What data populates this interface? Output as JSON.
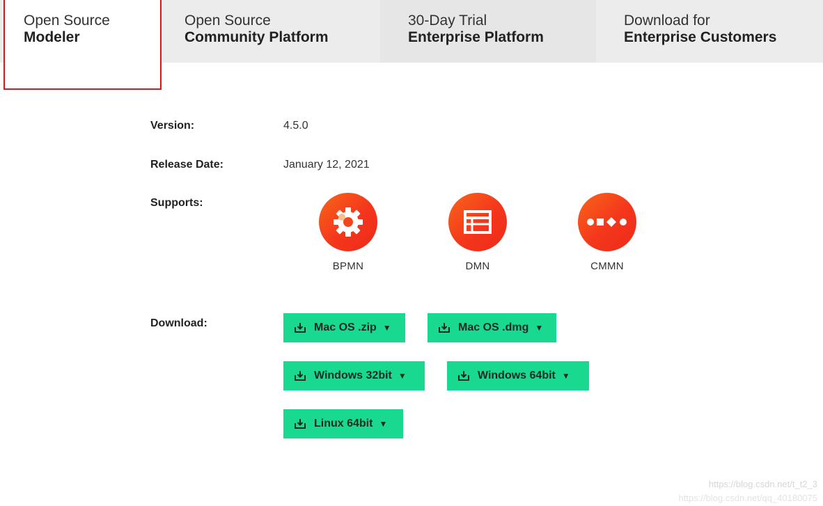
{
  "tabs": [
    {
      "line1": "Open Source",
      "line2": "Modeler",
      "active": true
    },
    {
      "line1": "Open Source",
      "line2": "Community Platform",
      "active": false
    },
    {
      "line1": "30-Day Trial",
      "line2": "Enterprise Platform",
      "active": false
    },
    {
      "line1": "Download for",
      "line2": "Enterprise Customers",
      "active": false
    }
  ],
  "info": {
    "version_label": "Version:",
    "version_value": "4.5.0",
    "release_label": "Release Date:",
    "release_value": "January 12, 2021",
    "supports_label": "Supports:",
    "download_label": "Download:"
  },
  "supports": [
    {
      "name": "BPMN",
      "icon": "gear-icon"
    },
    {
      "name": "DMN",
      "icon": "table-icon"
    },
    {
      "name": "CMMN",
      "icon": "case-shapes-icon"
    }
  ],
  "downloads": [
    {
      "label": "Mac OS .zip",
      "icon": "download-icon",
      "caret": "▼"
    },
    {
      "label": "Mac OS .dmg",
      "icon": "download-icon",
      "caret": "▼"
    },
    {
      "label": "Windows 32bit",
      "icon": "download-icon",
      "caret": "▼"
    },
    {
      "label": "Windows 64bit",
      "icon": "download-icon",
      "caret": "▼"
    },
    {
      "label": "Linux 64bit",
      "icon": "download-icon",
      "caret": "▼"
    }
  ],
  "watermark": {
    "line1": "https://blog.csdn.net/t_t2_3",
    "line2": "https://blog.csdn.net/qq_40180075"
  },
  "colors": {
    "active_tab_border": "#d9161e",
    "download_button": "#19d88f",
    "support_icon_orange": "#f4361c"
  }
}
